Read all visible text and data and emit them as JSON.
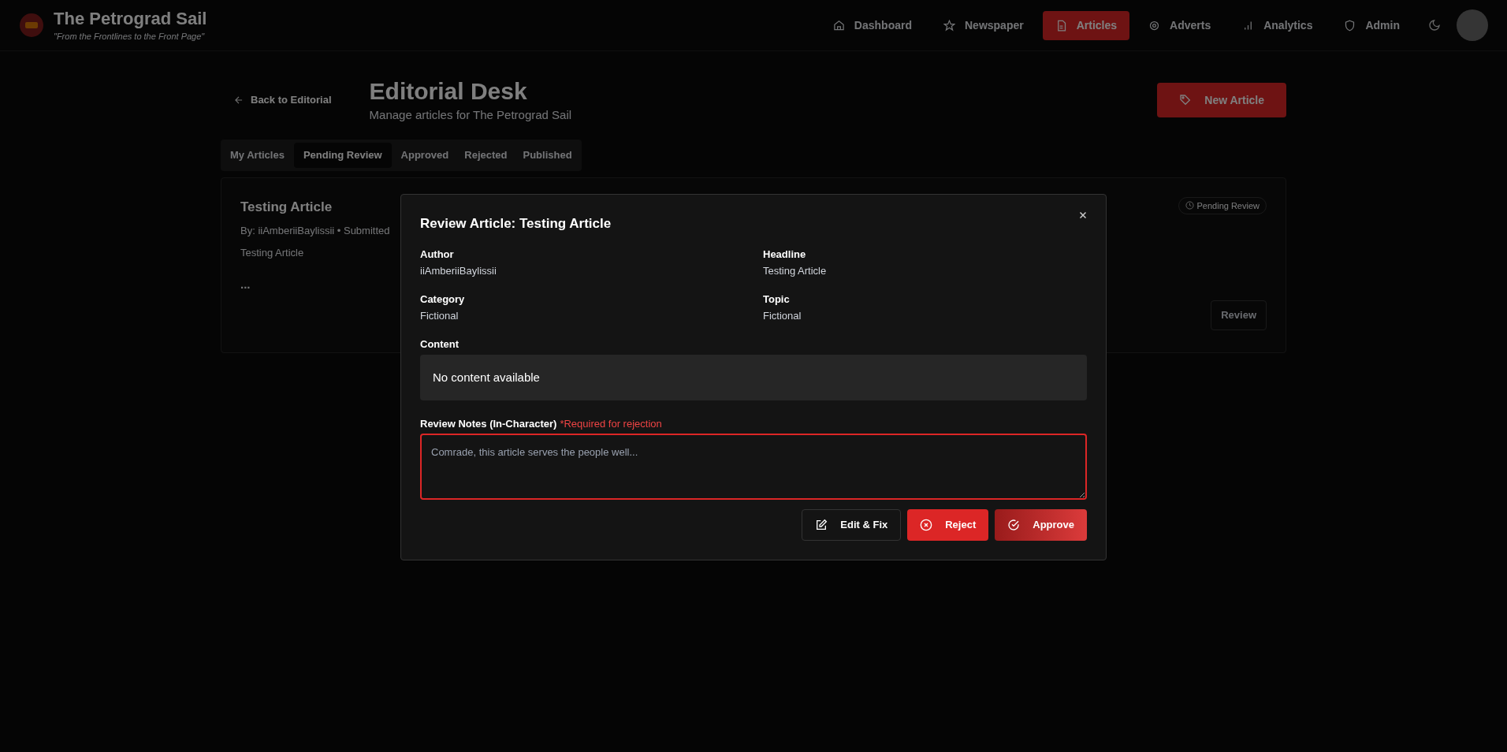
{
  "header": {
    "title": "The Petrograd Sail",
    "tagline": "\"From the Frontlines to the Front Page\"",
    "nav": [
      {
        "label": "Dashboard",
        "selected": false
      },
      {
        "label": "Newspaper",
        "selected": false
      },
      {
        "label": "Articles",
        "selected": true
      },
      {
        "label": "Adverts",
        "selected": false
      },
      {
        "label": "Analytics",
        "selected": false
      },
      {
        "label": "Admin",
        "selected": false
      }
    ]
  },
  "page": {
    "back_link": "Back to Editorial",
    "title": "Editorial Desk",
    "subtitle": "Manage articles for The Petrograd Sail",
    "new_button": "New Article",
    "tabs": [
      {
        "label": "My Articles",
        "selected": false
      },
      {
        "label": "Pending Review",
        "selected": true
      },
      {
        "label": "Approved",
        "selected": false
      },
      {
        "label": "Rejected",
        "selected": false
      },
      {
        "label": "Published",
        "selected": false
      }
    ],
    "article_card": {
      "title": "Testing Article",
      "byline": "By: iiAmberiiBaylissii • Submitted",
      "excerpt": "Testing Article",
      "ellipsis": "...",
      "status": "Pending Review",
      "review_button": "Review"
    }
  },
  "modal": {
    "title": "Review Article: Testing Article",
    "fields": [
      {
        "label": "Author",
        "value": "iiAmberiiBaylissii"
      },
      {
        "label": "Headline",
        "value": "Testing Article"
      },
      {
        "label": "Category",
        "value": "Fictional"
      },
      {
        "label": "Topic",
        "value": "Fictional"
      }
    ],
    "content_label": "Content",
    "content": "No content available",
    "notes_label": "Review Notes (In-Character)",
    "notes_required": "*Required for rejection",
    "notes_placeholder": "Comrade, this article serves the people well...",
    "buttons": [
      {
        "label": "Edit & Fix",
        "kind": "edit"
      },
      {
        "label": "Reject",
        "kind": "reject"
      },
      {
        "label": "Approve",
        "kind": "approve"
      }
    ]
  }
}
